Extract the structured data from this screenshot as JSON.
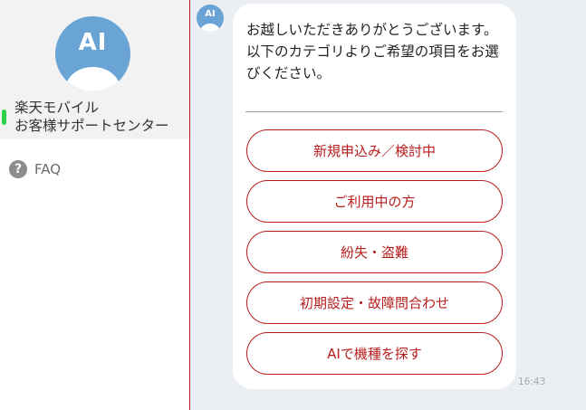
{
  "sidebar": {
    "avatar_text": "AI",
    "center_name": "楽天モバイル\nお客様サポートセンター",
    "faq_icon": "?",
    "faq_label": "FAQ",
    "status_color": "#2ed24a"
  },
  "chat": {
    "avatar_text": "AI",
    "message": "お越しいただきありがとうございます。\n以下のカテゴリよりご希望の項目をお選びください。",
    "options": [
      "新規申込み／検討中",
      "ご利用中の方",
      "紛失・盗難",
      "初期設定・故障問合わせ",
      "AIで機種を探す"
    ],
    "time": "16:43"
  },
  "colors": {
    "accent": "#b71c1c",
    "avatar": "#6aa4d4",
    "chat_bg": "#ebeff3"
  }
}
